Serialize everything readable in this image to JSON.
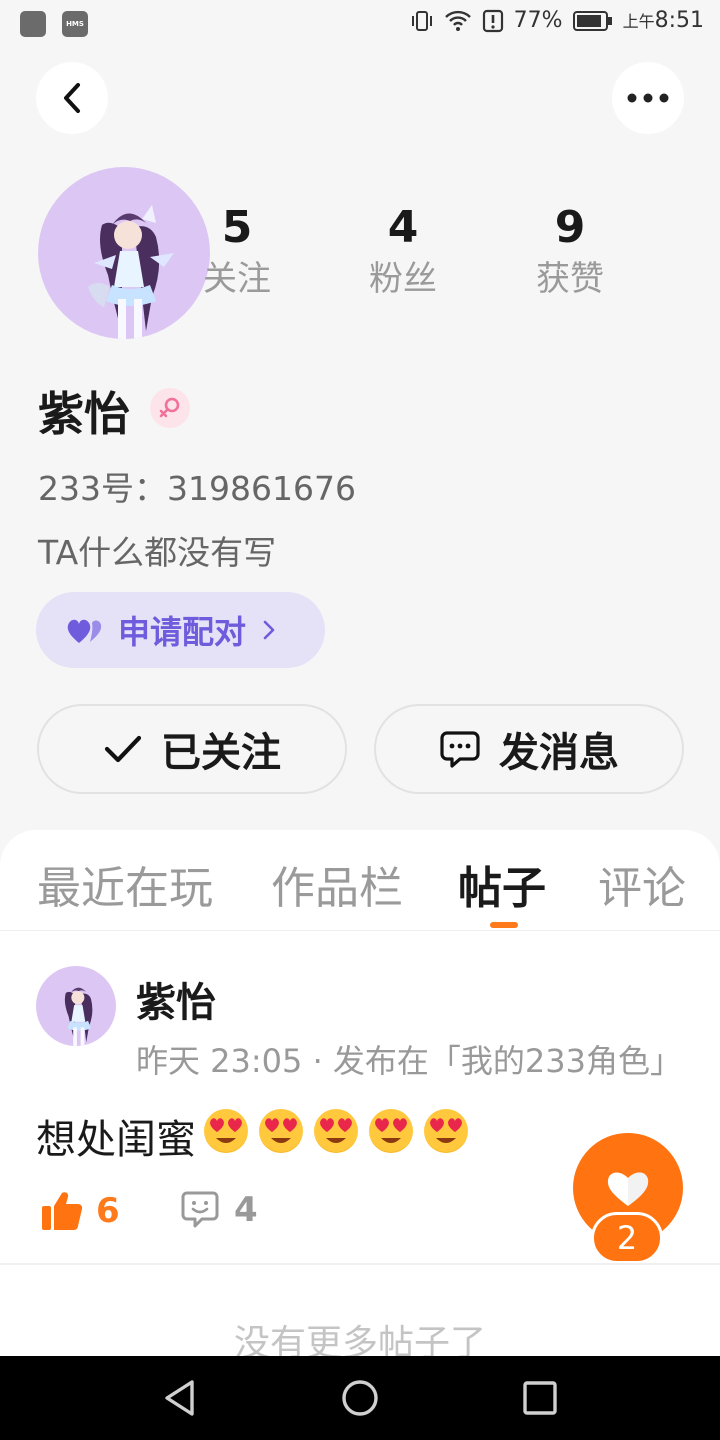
{
  "status_bar": {
    "battery": "77%",
    "time_prefix": "上午",
    "time": "8:51",
    "hms_label": "HMS"
  },
  "profile": {
    "following_count": "5",
    "following_label": "关注",
    "followers_count": "4",
    "followers_label": "粉丝",
    "likes_count": "9",
    "likes_label": "获赞",
    "name": "紫怡",
    "gender": "female",
    "uid_text": "233号：319861676",
    "bio": "TA什么都没有写",
    "pair_button_label": "申请配对",
    "follow_button_label": "已关注",
    "message_button_label": "发消息"
  },
  "tabs": [
    {
      "label": "最近在玩",
      "active": false
    },
    {
      "label": "作品栏",
      "active": false
    },
    {
      "label": "帖子",
      "active": true
    },
    {
      "label": "评论",
      "active": false
    }
  ],
  "post": {
    "author": "紫怡",
    "meta": "昨天 23:05 · 发布在「我的233角色」",
    "body_text": "想处闺蜜",
    "emoji": "heart-eyes-emoji",
    "emoji_count": 5,
    "like_count": "6",
    "comment_count": "4"
  },
  "fab": {
    "badge_count": "2"
  },
  "footer": {
    "no_more_text": "没有更多帖子了"
  },
  "colors": {
    "accent_orange": "#ff7410",
    "pair_purple": "#6f5cdd",
    "pair_bg": "#e5e2f8",
    "avatar_bg": "#dcc7f4"
  }
}
